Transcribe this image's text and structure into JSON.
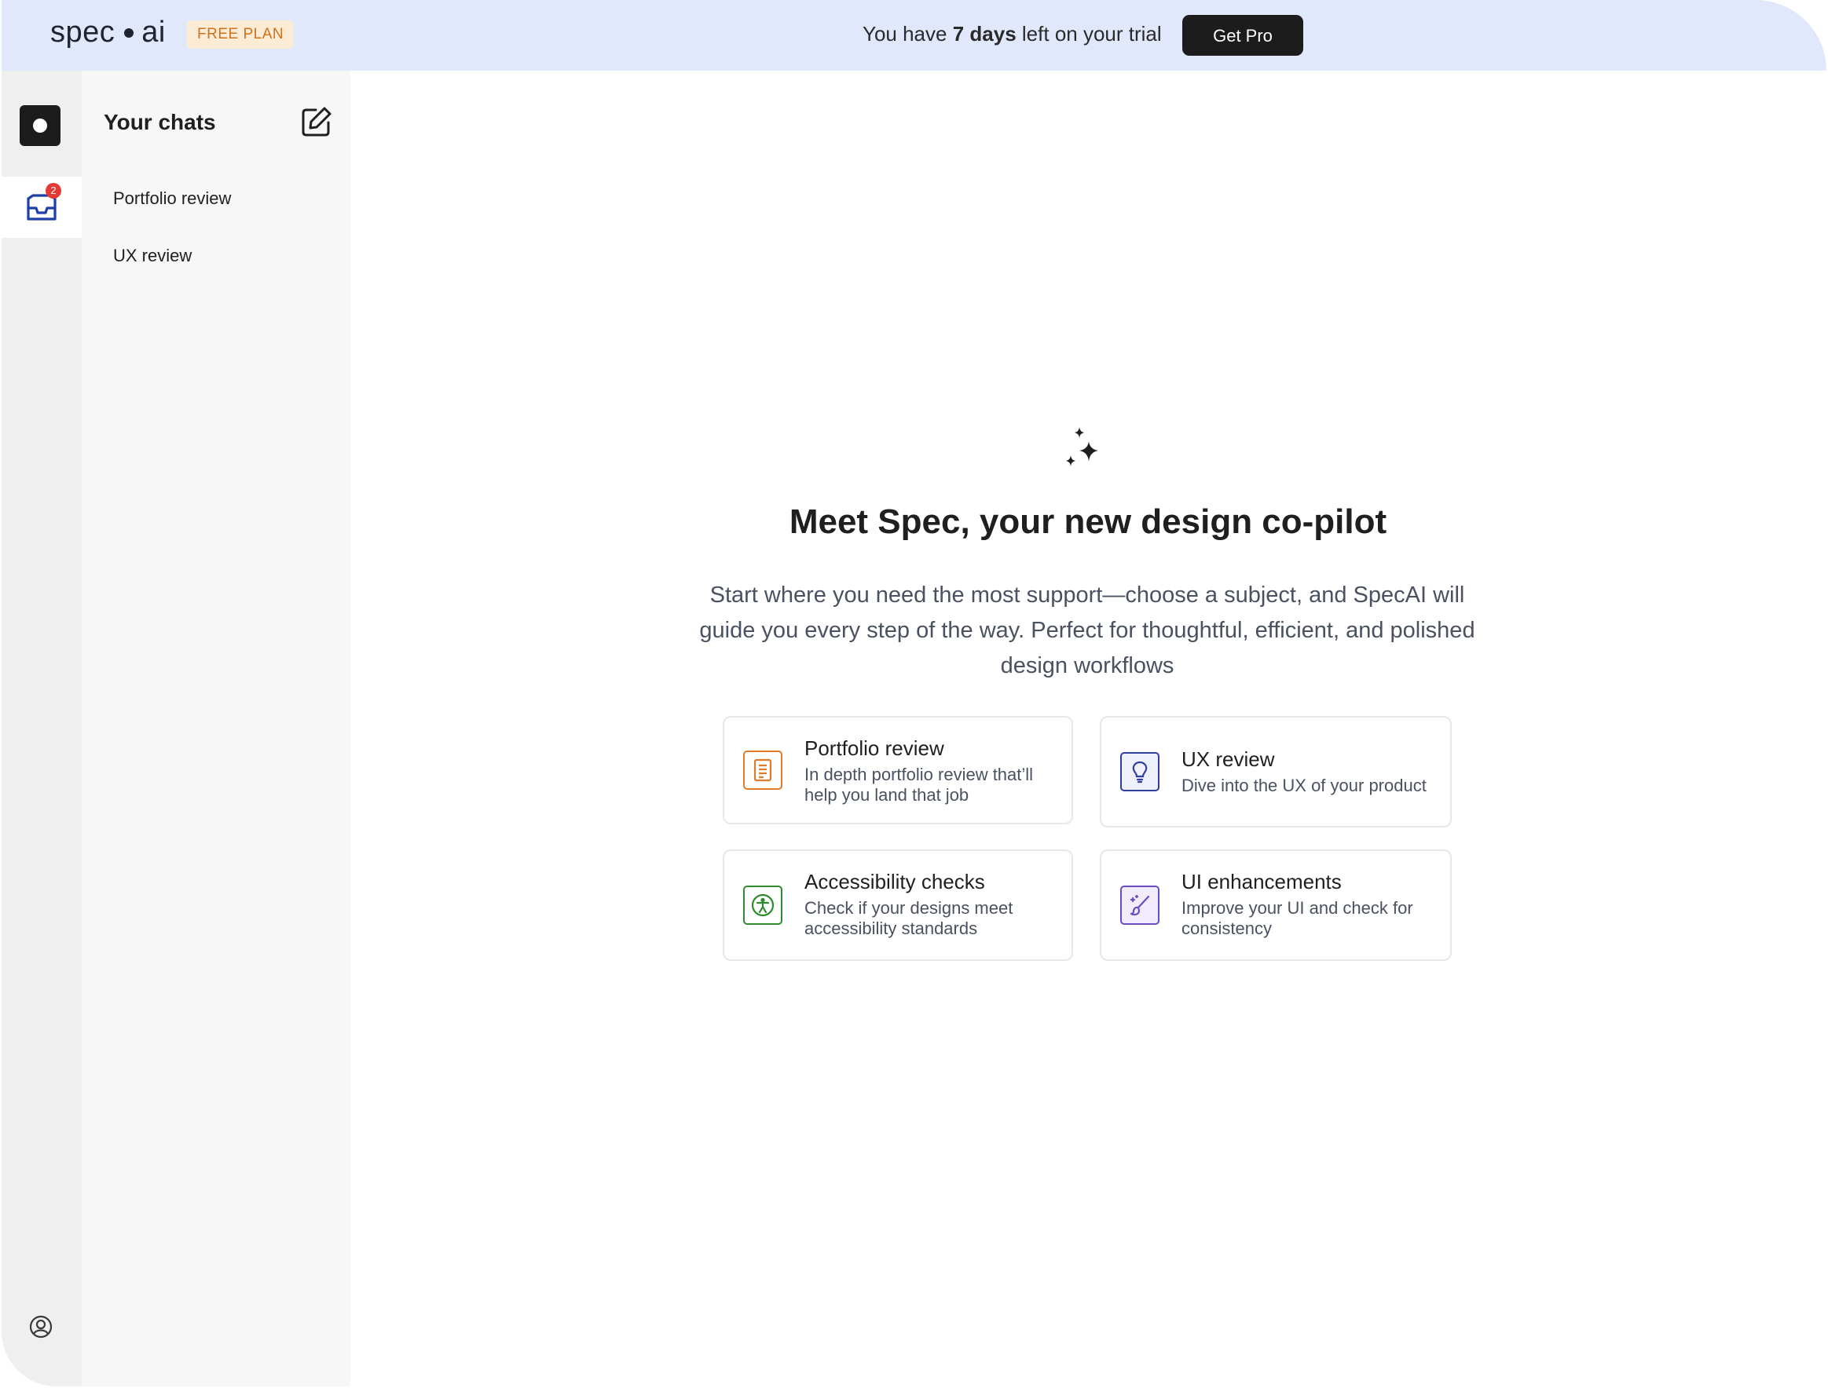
{
  "topbar": {
    "logo_left": "spec",
    "logo_right": "ai",
    "plan_badge": "FREE PLAN",
    "trial_prefix": "You have",
    "trial_days": "7 days",
    "trial_suffix": "left on your trial",
    "cta_label": "Get Pro"
  },
  "rail": {
    "inbox_badge_count": "2"
  },
  "sidebar": {
    "title": "Your chats",
    "chats": [
      {
        "label": "Portfolio review"
      },
      {
        "label": "UX review"
      }
    ]
  },
  "main": {
    "headline": "Meet Spec, your new design co-pilot",
    "subtitle": "Start where you need the most support—choose a subject, and SpecAI will guide you every step of the way. Perfect for thoughtful, efficient, and polished design workflows",
    "cards": [
      {
        "title": "Portfolio review",
        "desc": "In depth portfolio review that’ll help you land that job",
        "icon": "document-icon",
        "color": "#e07b2a"
      },
      {
        "title": "UX review",
        "desc": "Dive into the UX of your product",
        "icon": "lightbulb-icon",
        "color": "#2f3f9e"
      },
      {
        "title": "Accessibility checks",
        "desc": "Check if your designs meet accessibility standards",
        "icon": "accessibility-icon",
        "color": "#2e8b2e"
      },
      {
        "title": "UI enhancements",
        "desc": "Improve your UI and check for consistency",
        "icon": "brush-icon",
        "color": "#6a4cc4"
      }
    ]
  },
  "colors": {
    "topbar_bg": "#e2e8fb",
    "badge_text": "#d5701a",
    "cta_bg": "#1c1c1c",
    "notification": "#e53935"
  }
}
